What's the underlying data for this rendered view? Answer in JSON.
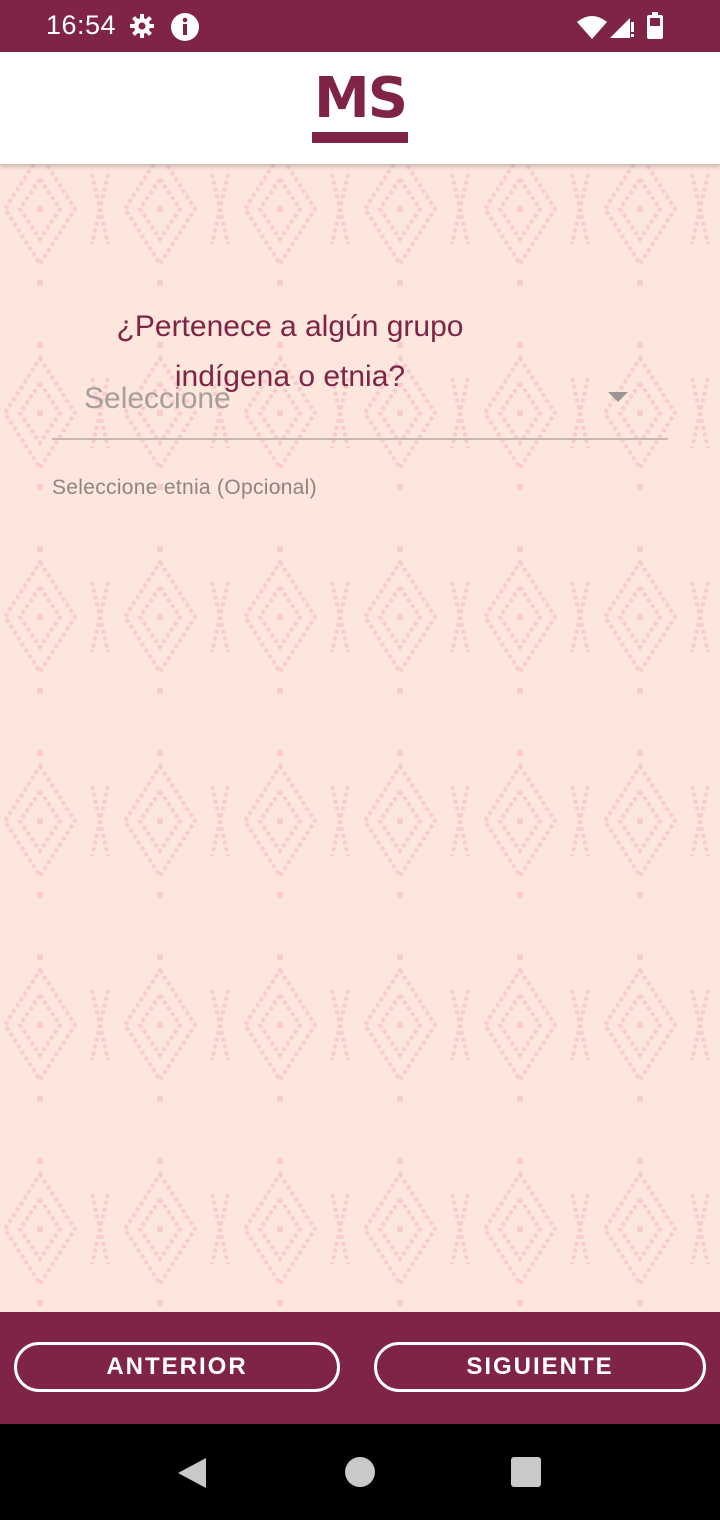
{
  "status_bar": {
    "time": "16:54",
    "icons": [
      "gear-icon",
      "info-icon",
      "wifi-icon",
      "signal-icon",
      "battery-icon"
    ]
  },
  "header": {
    "logo_text": "MS"
  },
  "form": {
    "question": "¿Pertenece a algún grupo indígena o etnia?",
    "select_value": "Seleccione",
    "helper_text": "Seleccione etnia (Opcional)"
  },
  "footer": {
    "prev_label": "ANTERIOR",
    "next_label": "SIGUIENTE"
  },
  "colors": {
    "brand": "#7f2446",
    "background": "#fde6dc",
    "pattern": "#f6bdc6"
  }
}
